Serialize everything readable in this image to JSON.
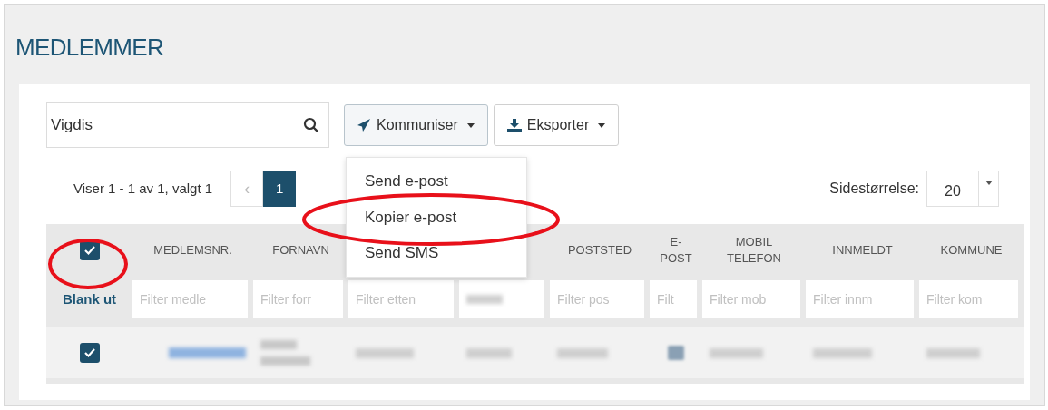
{
  "page": {
    "title": "MEDLEMMER"
  },
  "search": {
    "value": "Vigdis"
  },
  "actions": [
    {
      "label": "Kommuniser",
      "kind": "send",
      "expanded": true
    },
    {
      "label": "Eksporter",
      "kind": "download",
      "expanded": false
    }
  ],
  "menu": {
    "items": [
      {
        "label": "Send e-post"
      },
      {
        "label": "Kopier e-post"
      },
      {
        "label": "Send SMS"
      }
    ]
  },
  "paging": {
    "summary": "Viser 1 - 1 av 1, valgt 1",
    "prev": "‹",
    "pages": [
      {
        "label": "1",
        "selected": true
      }
    ],
    "page_size_label": "Sidestørrelse:",
    "page_size": "20"
  },
  "table": {
    "select_all": {
      "checked": true
    },
    "clear_label": "Blank ut",
    "columns": [
      {
        "header": "MEDLEMSNR.",
        "placeholder": "Filter medle"
      },
      {
        "header": "FORNAVN",
        "placeholder": "Filter forr"
      },
      {
        "placeholder": "Filter etten"
      },
      {
        "filter_redacted": true
      },
      {
        "header": "POSTSTED",
        "placeholder": "Filter pos"
      },
      {
        "header": "E-POST",
        "placeholder": "Filt"
      },
      {
        "header": "MOBIL TELEFON",
        "placeholder": "Filter mob"
      },
      {
        "header": "INNMELDT",
        "placeholder": "Filter innm"
      },
      {
        "header": "KOMMUNE",
        "placeholder": "Filter kom"
      }
    ],
    "rows": [
      {
        "checked": true,
        "cells": [
          {
            "kind": "link"
          },
          {
            "kind": "two-line"
          },
          {
            "kind": "text"
          },
          {
            "kind": "text"
          },
          {
            "kind": "text"
          },
          {
            "kind": "icon"
          },
          {
            "kind": "text"
          },
          {
            "kind": "text"
          },
          {
            "kind": "text"
          }
        ]
      }
    ]
  },
  "annotations": [
    {
      "kind": "ellipse"
    },
    {
      "kind": "ellipse"
    }
  ]
}
